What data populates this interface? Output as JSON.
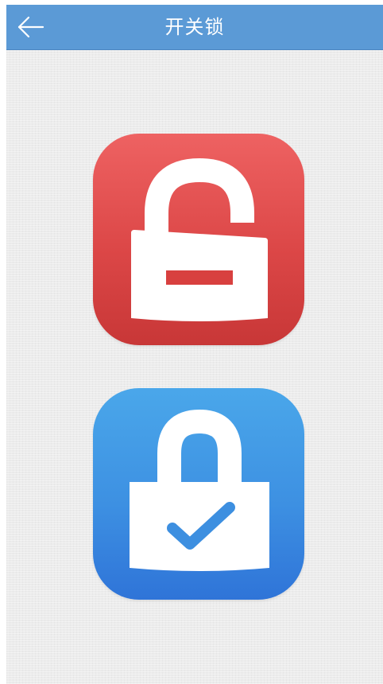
{
  "header": {
    "title": "开关锁",
    "back_icon": "arrow-left-icon",
    "background": "#5b9ad6"
  },
  "actions": [
    {
      "name": "unlock",
      "icon": "unlocked-padlock-icon",
      "color": "#dc4747"
    },
    {
      "name": "lock",
      "icon": "locked-padlock-check-icon",
      "color": "#3d90e2"
    }
  ]
}
